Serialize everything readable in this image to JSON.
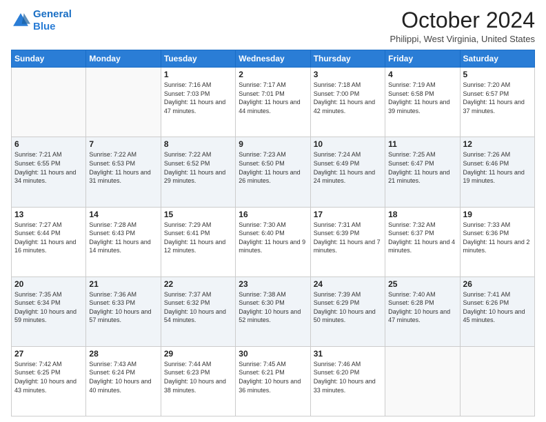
{
  "header": {
    "logo_line1": "General",
    "logo_line2": "Blue",
    "month_title": "October 2024",
    "location": "Philippi, West Virginia, United States"
  },
  "weekdays": [
    "Sunday",
    "Monday",
    "Tuesday",
    "Wednesday",
    "Thursday",
    "Friday",
    "Saturday"
  ],
  "weeks": [
    [
      {
        "day": "",
        "info": ""
      },
      {
        "day": "",
        "info": ""
      },
      {
        "day": "1",
        "info": "Sunrise: 7:16 AM\nSunset: 7:03 PM\nDaylight: 11 hours and 47 minutes."
      },
      {
        "day": "2",
        "info": "Sunrise: 7:17 AM\nSunset: 7:01 PM\nDaylight: 11 hours and 44 minutes."
      },
      {
        "day": "3",
        "info": "Sunrise: 7:18 AM\nSunset: 7:00 PM\nDaylight: 11 hours and 42 minutes."
      },
      {
        "day": "4",
        "info": "Sunrise: 7:19 AM\nSunset: 6:58 PM\nDaylight: 11 hours and 39 minutes."
      },
      {
        "day": "5",
        "info": "Sunrise: 7:20 AM\nSunset: 6:57 PM\nDaylight: 11 hours and 37 minutes."
      }
    ],
    [
      {
        "day": "6",
        "info": "Sunrise: 7:21 AM\nSunset: 6:55 PM\nDaylight: 11 hours and 34 minutes."
      },
      {
        "day": "7",
        "info": "Sunrise: 7:22 AM\nSunset: 6:53 PM\nDaylight: 11 hours and 31 minutes."
      },
      {
        "day": "8",
        "info": "Sunrise: 7:22 AM\nSunset: 6:52 PM\nDaylight: 11 hours and 29 minutes."
      },
      {
        "day": "9",
        "info": "Sunrise: 7:23 AM\nSunset: 6:50 PM\nDaylight: 11 hours and 26 minutes."
      },
      {
        "day": "10",
        "info": "Sunrise: 7:24 AM\nSunset: 6:49 PM\nDaylight: 11 hours and 24 minutes."
      },
      {
        "day": "11",
        "info": "Sunrise: 7:25 AM\nSunset: 6:47 PM\nDaylight: 11 hours and 21 minutes."
      },
      {
        "day": "12",
        "info": "Sunrise: 7:26 AM\nSunset: 6:46 PM\nDaylight: 11 hours and 19 minutes."
      }
    ],
    [
      {
        "day": "13",
        "info": "Sunrise: 7:27 AM\nSunset: 6:44 PM\nDaylight: 11 hours and 16 minutes."
      },
      {
        "day": "14",
        "info": "Sunrise: 7:28 AM\nSunset: 6:43 PM\nDaylight: 11 hours and 14 minutes."
      },
      {
        "day": "15",
        "info": "Sunrise: 7:29 AM\nSunset: 6:41 PM\nDaylight: 11 hours and 12 minutes."
      },
      {
        "day": "16",
        "info": "Sunrise: 7:30 AM\nSunset: 6:40 PM\nDaylight: 11 hours and 9 minutes."
      },
      {
        "day": "17",
        "info": "Sunrise: 7:31 AM\nSunset: 6:39 PM\nDaylight: 11 hours and 7 minutes."
      },
      {
        "day": "18",
        "info": "Sunrise: 7:32 AM\nSunset: 6:37 PM\nDaylight: 11 hours and 4 minutes."
      },
      {
        "day": "19",
        "info": "Sunrise: 7:33 AM\nSunset: 6:36 PM\nDaylight: 11 hours and 2 minutes."
      }
    ],
    [
      {
        "day": "20",
        "info": "Sunrise: 7:35 AM\nSunset: 6:34 PM\nDaylight: 10 hours and 59 minutes."
      },
      {
        "day": "21",
        "info": "Sunrise: 7:36 AM\nSunset: 6:33 PM\nDaylight: 10 hours and 57 minutes."
      },
      {
        "day": "22",
        "info": "Sunrise: 7:37 AM\nSunset: 6:32 PM\nDaylight: 10 hours and 54 minutes."
      },
      {
        "day": "23",
        "info": "Sunrise: 7:38 AM\nSunset: 6:30 PM\nDaylight: 10 hours and 52 minutes."
      },
      {
        "day": "24",
        "info": "Sunrise: 7:39 AM\nSunset: 6:29 PM\nDaylight: 10 hours and 50 minutes."
      },
      {
        "day": "25",
        "info": "Sunrise: 7:40 AM\nSunset: 6:28 PM\nDaylight: 10 hours and 47 minutes."
      },
      {
        "day": "26",
        "info": "Sunrise: 7:41 AM\nSunset: 6:26 PM\nDaylight: 10 hours and 45 minutes."
      }
    ],
    [
      {
        "day": "27",
        "info": "Sunrise: 7:42 AM\nSunset: 6:25 PM\nDaylight: 10 hours and 43 minutes."
      },
      {
        "day": "28",
        "info": "Sunrise: 7:43 AM\nSunset: 6:24 PM\nDaylight: 10 hours and 40 minutes."
      },
      {
        "day": "29",
        "info": "Sunrise: 7:44 AM\nSunset: 6:23 PM\nDaylight: 10 hours and 38 minutes."
      },
      {
        "day": "30",
        "info": "Sunrise: 7:45 AM\nSunset: 6:21 PM\nDaylight: 10 hours and 36 minutes."
      },
      {
        "day": "31",
        "info": "Sunrise: 7:46 AM\nSunset: 6:20 PM\nDaylight: 10 hours and 33 minutes."
      },
      {
        "day": "",
        "info": ""
      },
      {
        "day": "",
        "info": ""
      }
    ]
  ]
}
